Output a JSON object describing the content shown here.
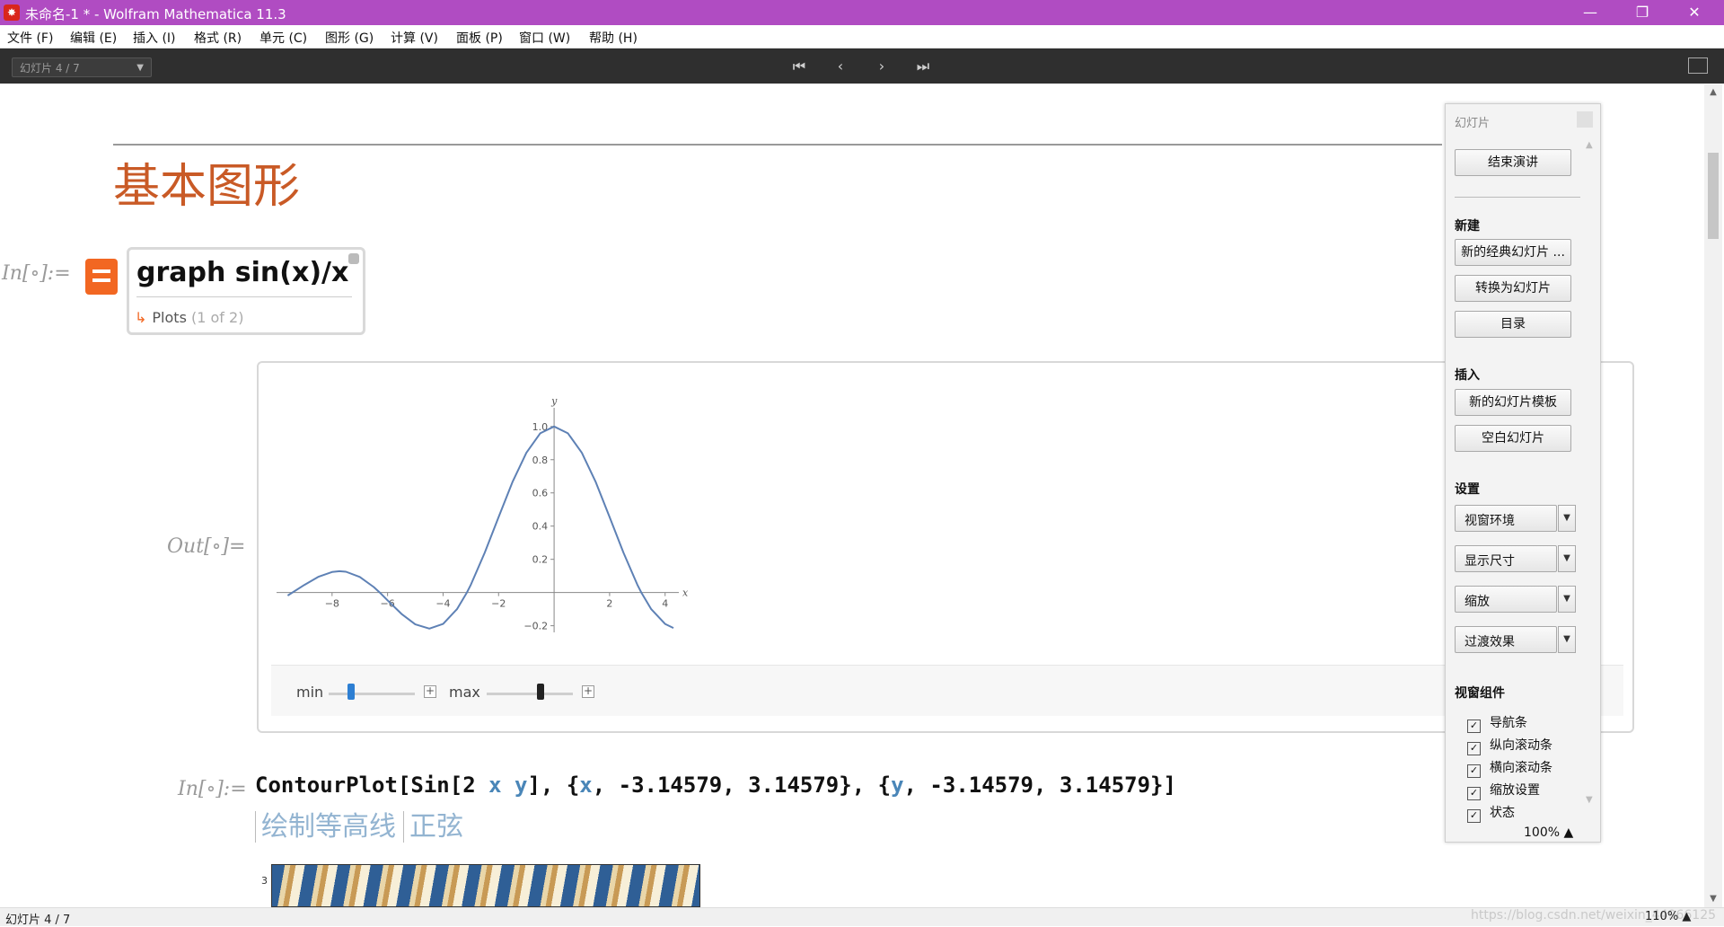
{
  "window": {
    "title": "未命名-1 * - Wolfram Mathematica 11.3",
    "controls": {
      "minimize": "—",
      "restore": "❐",
      "close": "✕"
    }
  },
  "menu": [
    "文件 (F)",
    "编辑 (E)",
    "插入 (I)",
    "格式 (R)",
    "单元 (C)",
    "图形 (G)",
    "计算 (V)",
    "面板 (P)",
    "窗口 (W)",
    "帮助 (H)"
  ],
  "toolbar": {
    "slide_select": "幻灯片 4 / 7",
    "nav": {
      "first": "⏮",
      "prev": "‹",
      "next": "›",
      "last": "⏭"
    }
  },
  "notebook": {
    "title": "基本图形",
    "in_label": "In[∘]:=",
    "out_label": "Out[∘]=",
    "wa_query": "graph sin(x)/x",
    "wa_plots_label": "Plots",
    "wa_plots_count": "(1 of 2)",
    "controls": {
      "min_label": "min",
      "max_label": "max",
      "min_value": 0.26,
      "max_value": 0.62
    },
    "contour_input": {
      "fn": "ContourPlot",
      "expr_open": "[Sin[2 ",
      "x": "x",
      "y": "y",
      "expr_close": "], {",
      "x2": "x",
      "range_x": ", -3.14579, 3.14579}, {",
      "y2": "y",
      "range_y": ", -3.14579, 3.14579}]"
    },
    "contour_hints": [
      "绘制等高线",
      "正弦"
    ],
    "contour_tick": "3"
  },
  "chart_data": {
    "type": "line",
    "title": "",
    "xlabel": "x",
    "ylabel": "y",
    "xlim": [
      -10,
      4.3
    ],
    "ylim": [
      -0.24,
      1.08
    ],
    "xticks": [
      -8,
      -6,
      -4,
      -2,
      2,
      4
    ],
    "yticks": [
      -0.2,
      0.2,
      0.4,
      0.6,
      0.8,
      1.0
    ],
    "xtick_labels": [
      "−8",
      "−6",
      "−4",
      "−2",
      "2",
      "4"
    ],
    "ytick_labels": [
      "−0.2",
      "0.2",
      "0.4",
      "0.6",
      "0.8",
      "1.0"
    ],
    "series": [
      {
        "function": "sin(x)/x",
        "color": "#5e81b5",
        "x": [
          -9.6,
          -9.0,
          -8.5,
          -8.0,
          -7.725,
          -7.5,
          -7.0,
          -6.5,
          -6.283,
          -6.0,
          -5.5,
          -5.0,
          -4.493,
          -4.0,
          -3.5,
          -3.142,
          -3.0,
          -2.5,
          -2.0,
          -1.5,
          -1.0,
          -0.5,
          0.0,
          0.5,
          1.0,
          1.5,
          2.0,
          2.5,
          3.0,
          3.142,
          3.5,
          4.0,
          4.3
        ],
        "y": [
          -0.0181,
          0.0458,
          0.0941,
          0.1237,
          0.1283,
          0.1251,
          0.0939,
          0.0331,
          0.0,
          -0.0466,
          -0.1286,
          -0.1918,
          -0.2172,
          -0.1892,
          -0.1002,
          0.0,
          0.047,
          0.2394,
          0.4546,
          0.665,
          0.8415,
          0.9589,
          1.0,
          0.9589,
          0.8415,
          0.665,
          0.4546,
          0.2394,
          0.047,
          0.0,
          -0.1002,
          -0.1892,
          -0.2134
        ]
      }
    ]
  },
  "palette": {
    "title": "幻灯片",
    "end_button": "结束演讲",
    "sections": {
      "new": "新建",
      "insert": "插入",
      "settings": "设置",
      "widgets": "视窗组件"
    },
    "new_buttons": [
      "新的经典幻灯片 ...",
      "转换为幻灯片",
      "目录"
    ],
    "insert_buttons": [
      "新的幻灯片模板",
      "空白幻灯片"
    ],
    "settings_dropdowns": [
      "视窗环境",
      "显示尺寸",
      "缩放",
      "过渡效果"
    ],
    "widgets": [
      "导航条",
      "纵向滚动条",
      "横向滚动条",
      "缩放设置",
      "状态"
    ],
    "zoom": "100%"
  },
  "status": {
    "text": "幻灯片 4 / 7",
    "zoom": "110%",
    "watermark": "https://blog.csdn.net/weixin_44966125"
  },
  "colors": {
    "titlebar": "#b04cc2",
    "toolbar": "#2f2f2f",
    "title_orange": "#c95a26",
    "wa_orange": "#f26722",
    "plot_line": "#5e81b5"
  }
}
